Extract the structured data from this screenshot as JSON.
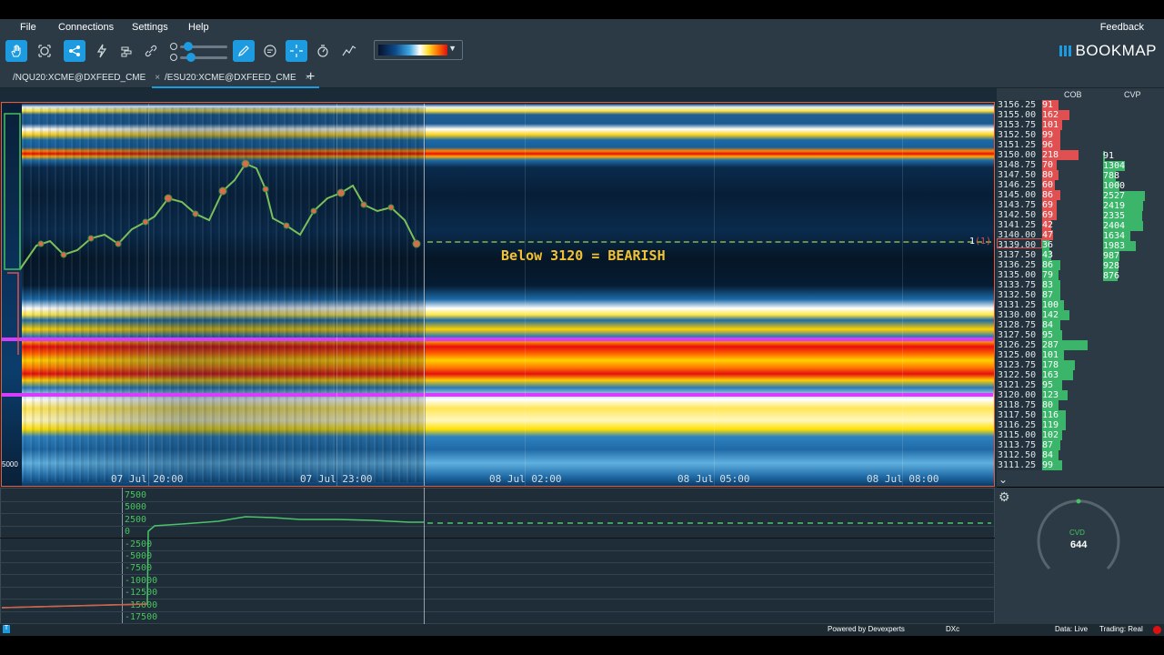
{
  "menu": {
    "file": "File",
    "connections": "Connections",
    "settings": "Settings",
    "help": "Help",
    "feedback": "Feedback"
  },
  "brand": "BOOKMAP",
  "tabs": [
    {
      "label": "/NQU20:XCME@DXFEED_CME",
      "close": "×"
    },
    {
      "label": "/ESU20:XCME@DXFEED_CME",
      "close": "×"
    }
  ],
  "tab_add": "+",
  "chart": {
    "annotation": "Below 3120 = BEARISH",
    "position_label": "1",
    "position_sub": "(1)",
    "left_volume": "5000",
    "time_ticks": [
      "07 Jul 20:00",
      "07 Jul 23:00",
      "08 Jul 02:00",
      "08 Jul 05:00",
      "08 Jul 08:00"
    ]
  },
  "ladder": {
    "cob_header": "COB",
    "cvp_header": "CVP",
    "prices": [
      "3156.25",
      "3155.00",
      "3153.75",
      "3152.50",
      "3151.25",
      "3150.00",
      "3148.75",
      "3147.50",
      "3146.25",
      "3145.00",
      "3143.75",
      "3142.50",
      "3141.25",
      "3140.00",
      "3139.00",
      "3137.50",
      "3136.25",
      "3135.00",
      "3133.75",
      "3132.50",
      "3131.25",
      "3130.00",
      "3128.75",
      "3127.50",
      "3126.25",
      "3125.00",
      "3123.75",
      "3122.50",
      "3121.25",
      "3120.00",
      "3118.75",
      "3117.50",
      "3116.25",
      "3115.00",
      "3113.75",
      "3112.50",
      "3111.25"
    ],
    "cob_ask": [
      "91",
      "162",
      "101",
      "99",
      "96",
      "218",
      "70",
      "80",
      "60",
      "86",
      "69",
      "69",
      "42",
      "47"
    ],
    "cob_bid": [
      "36",
      "43",
      "86",
      "79",
      "83",
      "87",
      "100",
      "142",
      "84",
      "95",
      "287",
      "101",
      "178",
      "163",
      "95",
      "123",
      "80",
      "116",
      "119",
      "102",
      "87",
      "84",
      "99"
    ],
    "cvp": [
      "91",
      "1304",
      "788",
      "1000",
      "2527",
      "2419",
      "2335",
      "2404",
      "1634",
      "1983",
      "987",
      "928",
      "876"
    ]
  },
  "cvd": {
    "axis_labels": [
      "7500",
      "5000",
      "2500",
      "0",
      "-2500",
      "-5000",
      "-7500",
      "-10000",
      "-12500",
      "-15000",
      "-17500"
    ],
    "label": "CVD",
    "value": "644"
  },
  "status": {
    "info": "T",
    "powered_by": "Powered by Devexperts",
    "dxc": "DXc",
    "data": "Data: Live",
    "trading": "Trading: Real"
  },
  "colors": {
    "accent": "#1d9be0",
    "annotation": "#f3c233",
    "bid_green": "#3ab56a",
    "ask_red": "#e05050",
    "magenta_line": "#d83cff"
  }
}
